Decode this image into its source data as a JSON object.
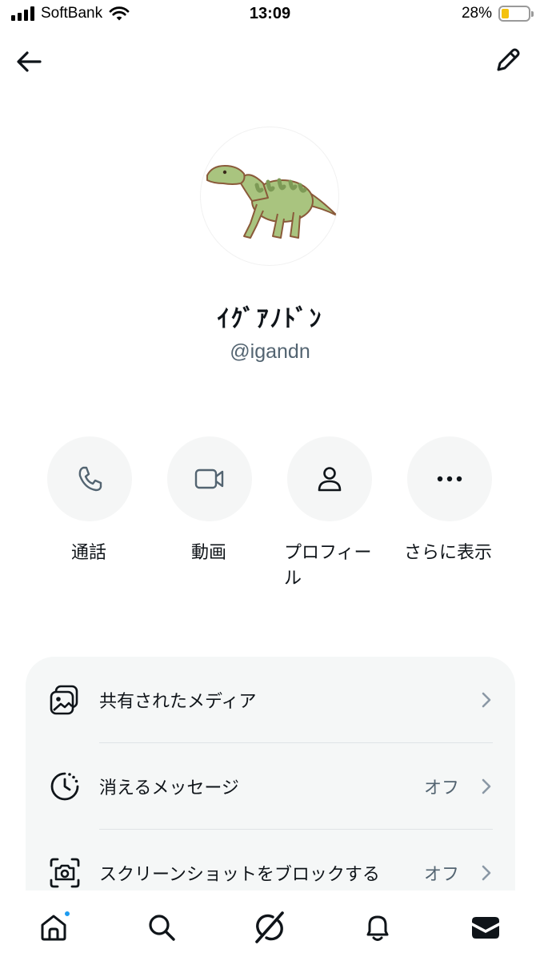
{
  "status_bar": {
    "carrier": "SoftBank",
    "time": "13:09",
    "battery_percent": "28%",
    "battery_level": 0.28,
    "battery_color": "#f4c20d"
  },
  "nav": {
    "back_icon": "arrow-left-icon",
    "edit_icon": "pencil-icon"
  },
  "profile": {
    "display_name": "ｲｸﾞｱﾉﾄﾞﾝ",
    "handle": "@igandn",
    "avatar": "dinosaur-avatar"
  },
  "actions": [
    {
      "label": "通話",
      "icon": "phone-icon"
    },
    {
      "label": "動画",
      "icon": "video-camera-icon"
    },
    {
      "label": "プロフィール",
      "icon": "person-icon"
    },
    {
      "label": "さらに表示",
      "icon": "more-dots-icon"
    }
  ],
  "settings": {
    "shared_media": {
      "label": "共有されたメディア",
      "icon": "media-gallery-icon"
    },
    "disappearing_messages": {
      "label": "消えるメッセージ",
      "value": "オフ",
      "icon": "timer-icon"
    },
    "block_screenshots": {
      "label": "スクリーンショットをブロックする",
      "value": "オフ",
      "icon": "screenshot-camera-icon"
    }
  },
  "tab_bar": {
    "items": [
      {
        "icon": "home-icon",
        "has_badge": true
      },
      {
        "icon": "search-icon"
      },
      {
        "icon": "grok-icon"
      },
      {
        "icon": "bell-icon"
      },
      {
        "icon": "mail-icon",
        "active": true
      }
    ],
    "badge_color": "#1d9bf0"
  }
}
